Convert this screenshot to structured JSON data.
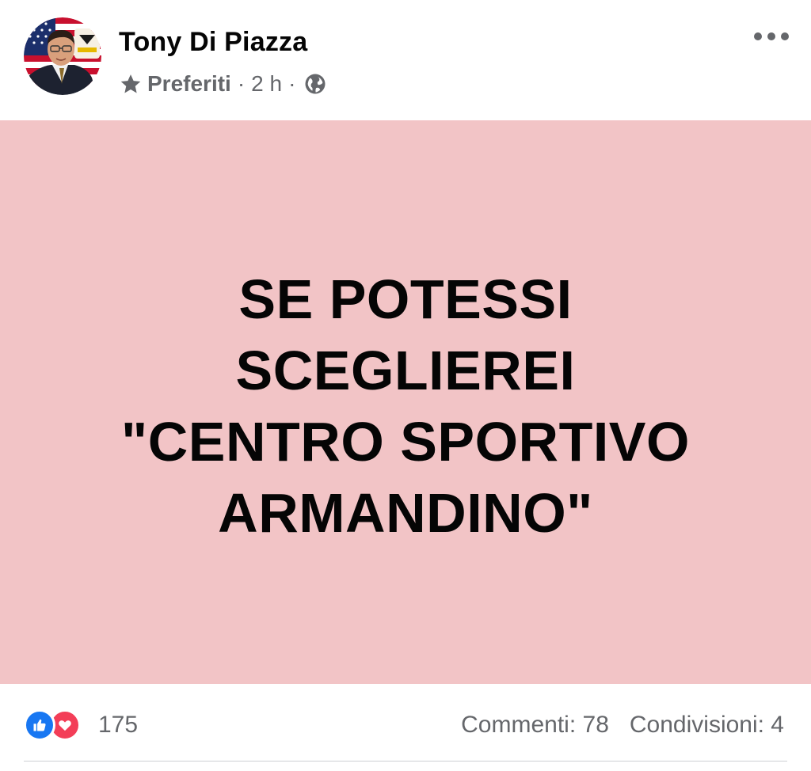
{
  "post": {
    "author": {
      "name": "Tony Di Piazza",
      "avatar_icon": "avatar-photo"
    },
    "meta": {
      "audience_icon": "star-icon",
      "audience": "Preferiti",
      "separator": "·",
      "time": "2 h",
      "privacy_icon": "globe-icon"
    },
    "more_icon": "more-options-icon",
    "content": {
      "background_color": "#f2c4c6",
      "lines": [
        "SE POTESSI",
        "SCEGLIEREI",
        "\"CENTRO SPORTIVO",
        "ARMANDINO\""
      ]
    },
    "footer": {
      "reaction_icons": [
        "like-icon",
        "love-icon"
      ],
      "reaction_count": "175",
      "comments": "Commenti: 78",
      "shares": "Condivisioni: 4"
    }
  }
}
